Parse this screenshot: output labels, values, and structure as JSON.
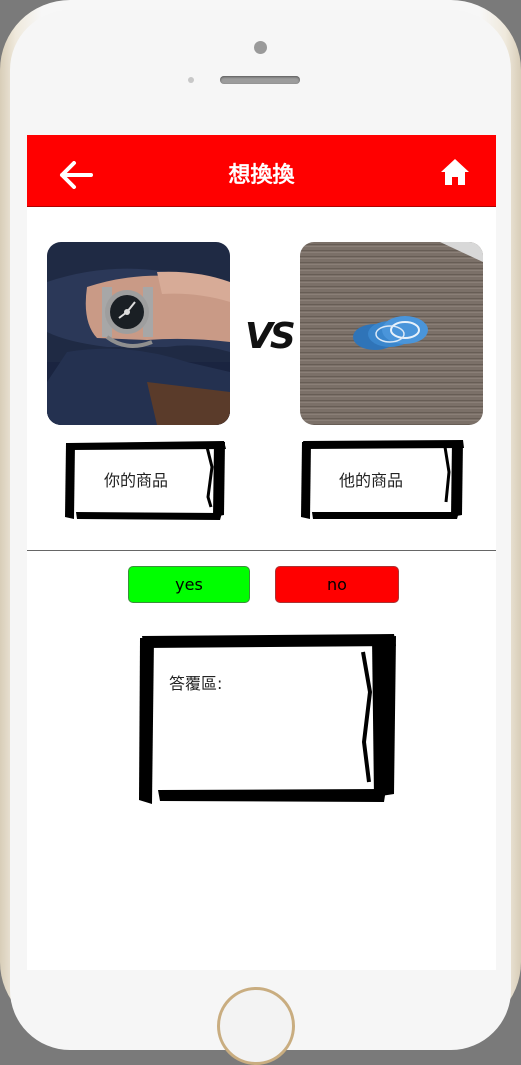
{
  "header": {
    "title": "想換換",
    "back_icon": "arrow-left-icon",
    "home_icon": "home-icon",
    "bg_color": "#ff0000"
  },
  "items": {
    "yours": {
      "label": "你的商品",
      "image": "wristwatch-photo"
    },
    "theirs": {
      "label": "他的商品",
      "image": "poker-chips-photo"
    },
    "vs_text": "VS"
  },
  "actions": {
    "yes_label": "yes",
    "no_label": "no",
    "yes_color": "#00ff00",
    "no_color": "#ff0000"
  },
  "reply": {
    "label": "答覆區:"
  }
}
